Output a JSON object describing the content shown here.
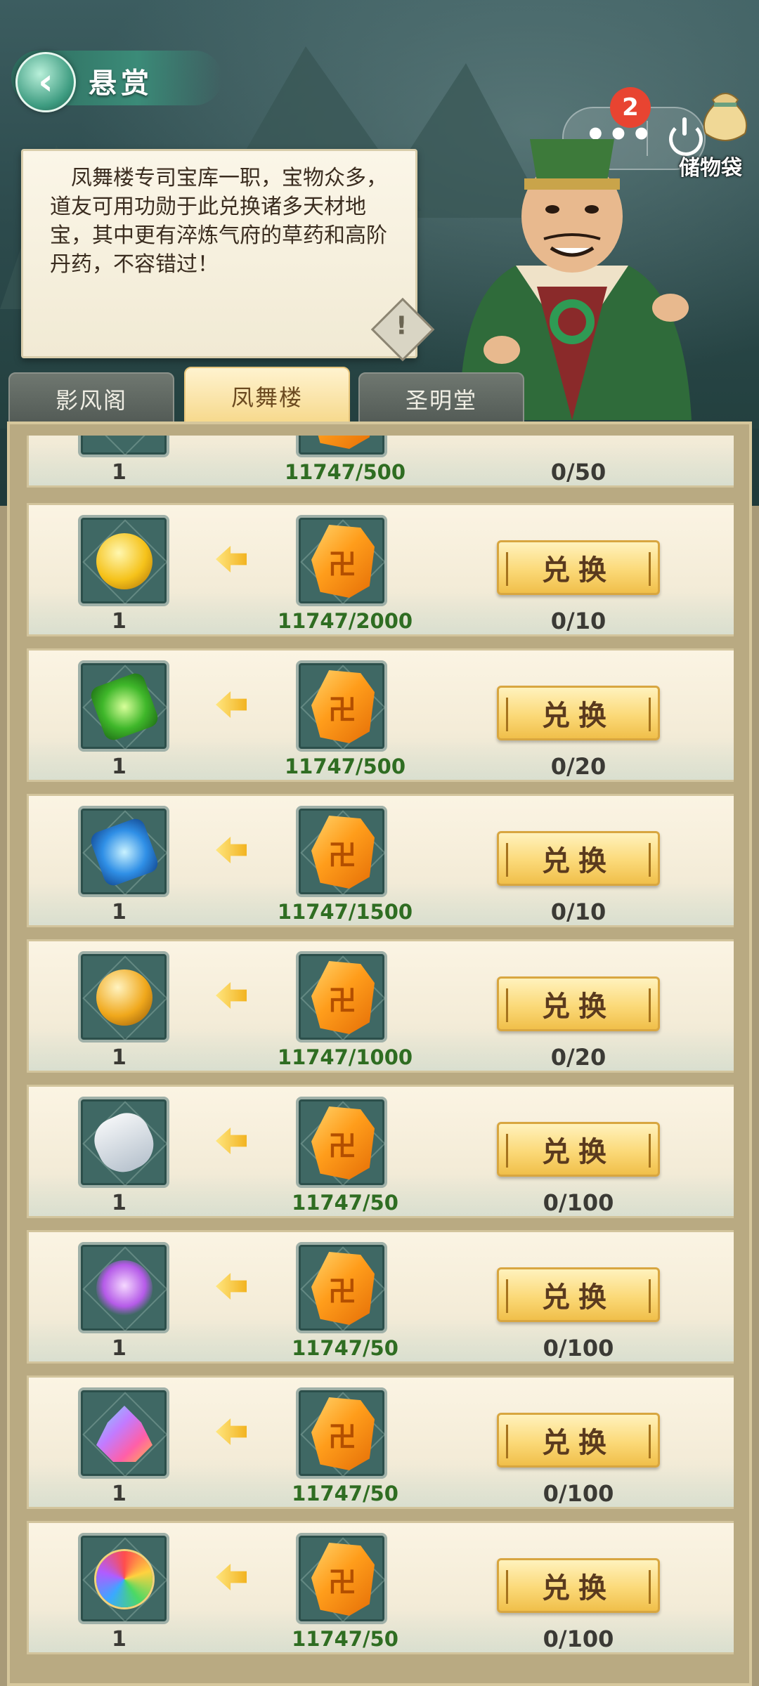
{
  "header": {
    "title": "悬赏",
    "notification_count": "2",
    "storage_label": "储物袋"
  },
  "dialog": {
    "text": "凤舞楼专司宝库一职，宝物众多，道友可用功勋于此兑换诸多天材地宝，其中更有淬炼气府的草药和高阶丹药，不容错过！"
  },
  "tabs": [
    {
      "label": "影风阁",
      "active": false
    },
    {
      "label": "凤舞楼",
      "active": true
    },
    {
      "label": "圣明堂",
      "active": false
    }
  ],
  "exchange": {
    "button_label": "兑换",
    "partial_row": {
      "quantity": "1",
      "cost": "11747/500",
      "limit": "0/50"
    },
    "rows": [
      {
        "reward_icon": "golden-flame-orb-icon",
        "quantity": "1",
        "cost_icon": "merit-crystal-icon",
        "cost": "11747/2000",
        "limit": "0/10"
      },
      {
        "reward_icon": "green-jade-talisman-icon",
        "quantity": "1",
        "cost_icon": "merit-crystal-icon",
        "cost": "11747/500",
        "limit": "0/20"
      },
      {
        "reward_icon": "blue-spirit-talisman-icon",
        "quantity": "1",
        "cost_icon": "merit-crystal-icon",
        "cost": "11747/1500",
        "limit": "0/10"
      },
      {
        "reward_icon": "golden-pearl-icon",
        "quantity": "1",
        "cost_icon": "merit-crystal-icon",
        "cost": "11747/1000",
        "limit": "0/20"
      },
      {
        "reward_icon": "porcelain-vase-icon",
        "quantity": "1",
        "cost_icon": "merit-crystal-icon",
        "cost": "11747/50",
        "limit": "0/100"
      },
      {
        "reward_icon": "purple-spirit-herb-icon",
        "quantity": "1",
        "cost_icon": "merit-crystal-icon",
        "cost": "11747/50",
        "limit": "0/100"
      },
      {
        "reward_icon": "rainbow-crystal-cluster-icon",
        "quantity": "1",
        "cost_icon": "merit-crystal-icon",
        "cost": "11747/50",
        "limit": "0/100"
      },
      {
        "reward_icon": "rainbow-orb-icon",
        "quantity": "1",
        "cost_icon": "merit-crystal-icon",
        "cost": "11747/50",
        "limit": "0/100"
      }
    ]
  }
}
